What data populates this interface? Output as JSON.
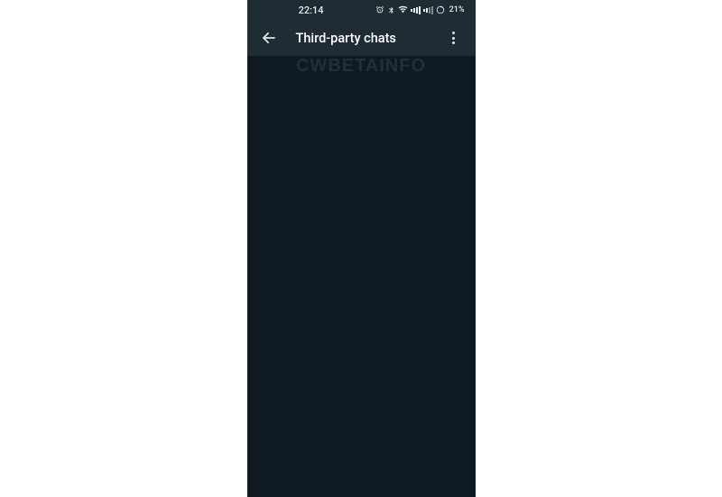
{
  "status_bar": {
    "time": "22:14",
    "battery_percent": "21%",
    "icons": {
      "alarm": "alarm-icon",
      "bluetooth": "bluetooth-icon",
      "wifi": "wifi-icon",
      "signal1": "signal-icon",
      "signal2": "signal-icon",
      "battery": "battery-icon"
    }
  },
  "app_bar": {
    "title": "Third-party chats",
    "back_icon": "arrow-left-icon",
    "menu_icon": "more-vertical-icon"
  },
  "watermark": "CWBETAINFO",
  "colors": {
    "header_bg": "#1f2c34",
    "body_bg": "#0f1921",
    "text_primary": "#e9edef"
  }
}
